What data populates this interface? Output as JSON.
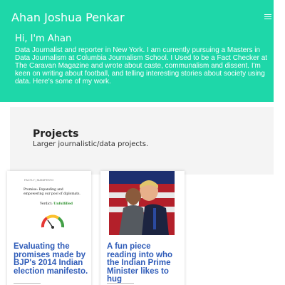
{
  "header": {
    "site_title": "Ahan Joshua Penkar",
    "menu_icon": "hamburger-menu-icon",
    "bg_color": "#1ed7a9"
  },
  "intro": {
    "greeting": "Hi, I'm Ahan",
    "bio": "Data Journalist and reporter in New York. I am currently pursuing a Masters in Data Journalism at Columbia Journalism School. I Used to be a Fact Checker at The Caravan Magazine and wrote about caste, communalism and dissent. I'm keen on writing about football, and telling interesting stories about society using data. Here's some of my work."
  },
  "projects": {
    "title": "Projects",
    "subtitle": "Larger journalistic/data projects."
  },
  "cards": [
    {
      "title": "Evaluating the promises made by BJP's 2014 Indian election manifesto.",
      "image": {
        "header": "FACTLY  |  MANIFESTO",
        "promise_text": "Promise: Expanding and empowering our pool of diplomats.",
        "verdict_label": "Verdict:",
        "verdict_value": "Unfulfilled"
      }
    },
    {
      "title": "A fun piece reading into who the Indian Prime Minister likes to hug"
    }
  ]
}
